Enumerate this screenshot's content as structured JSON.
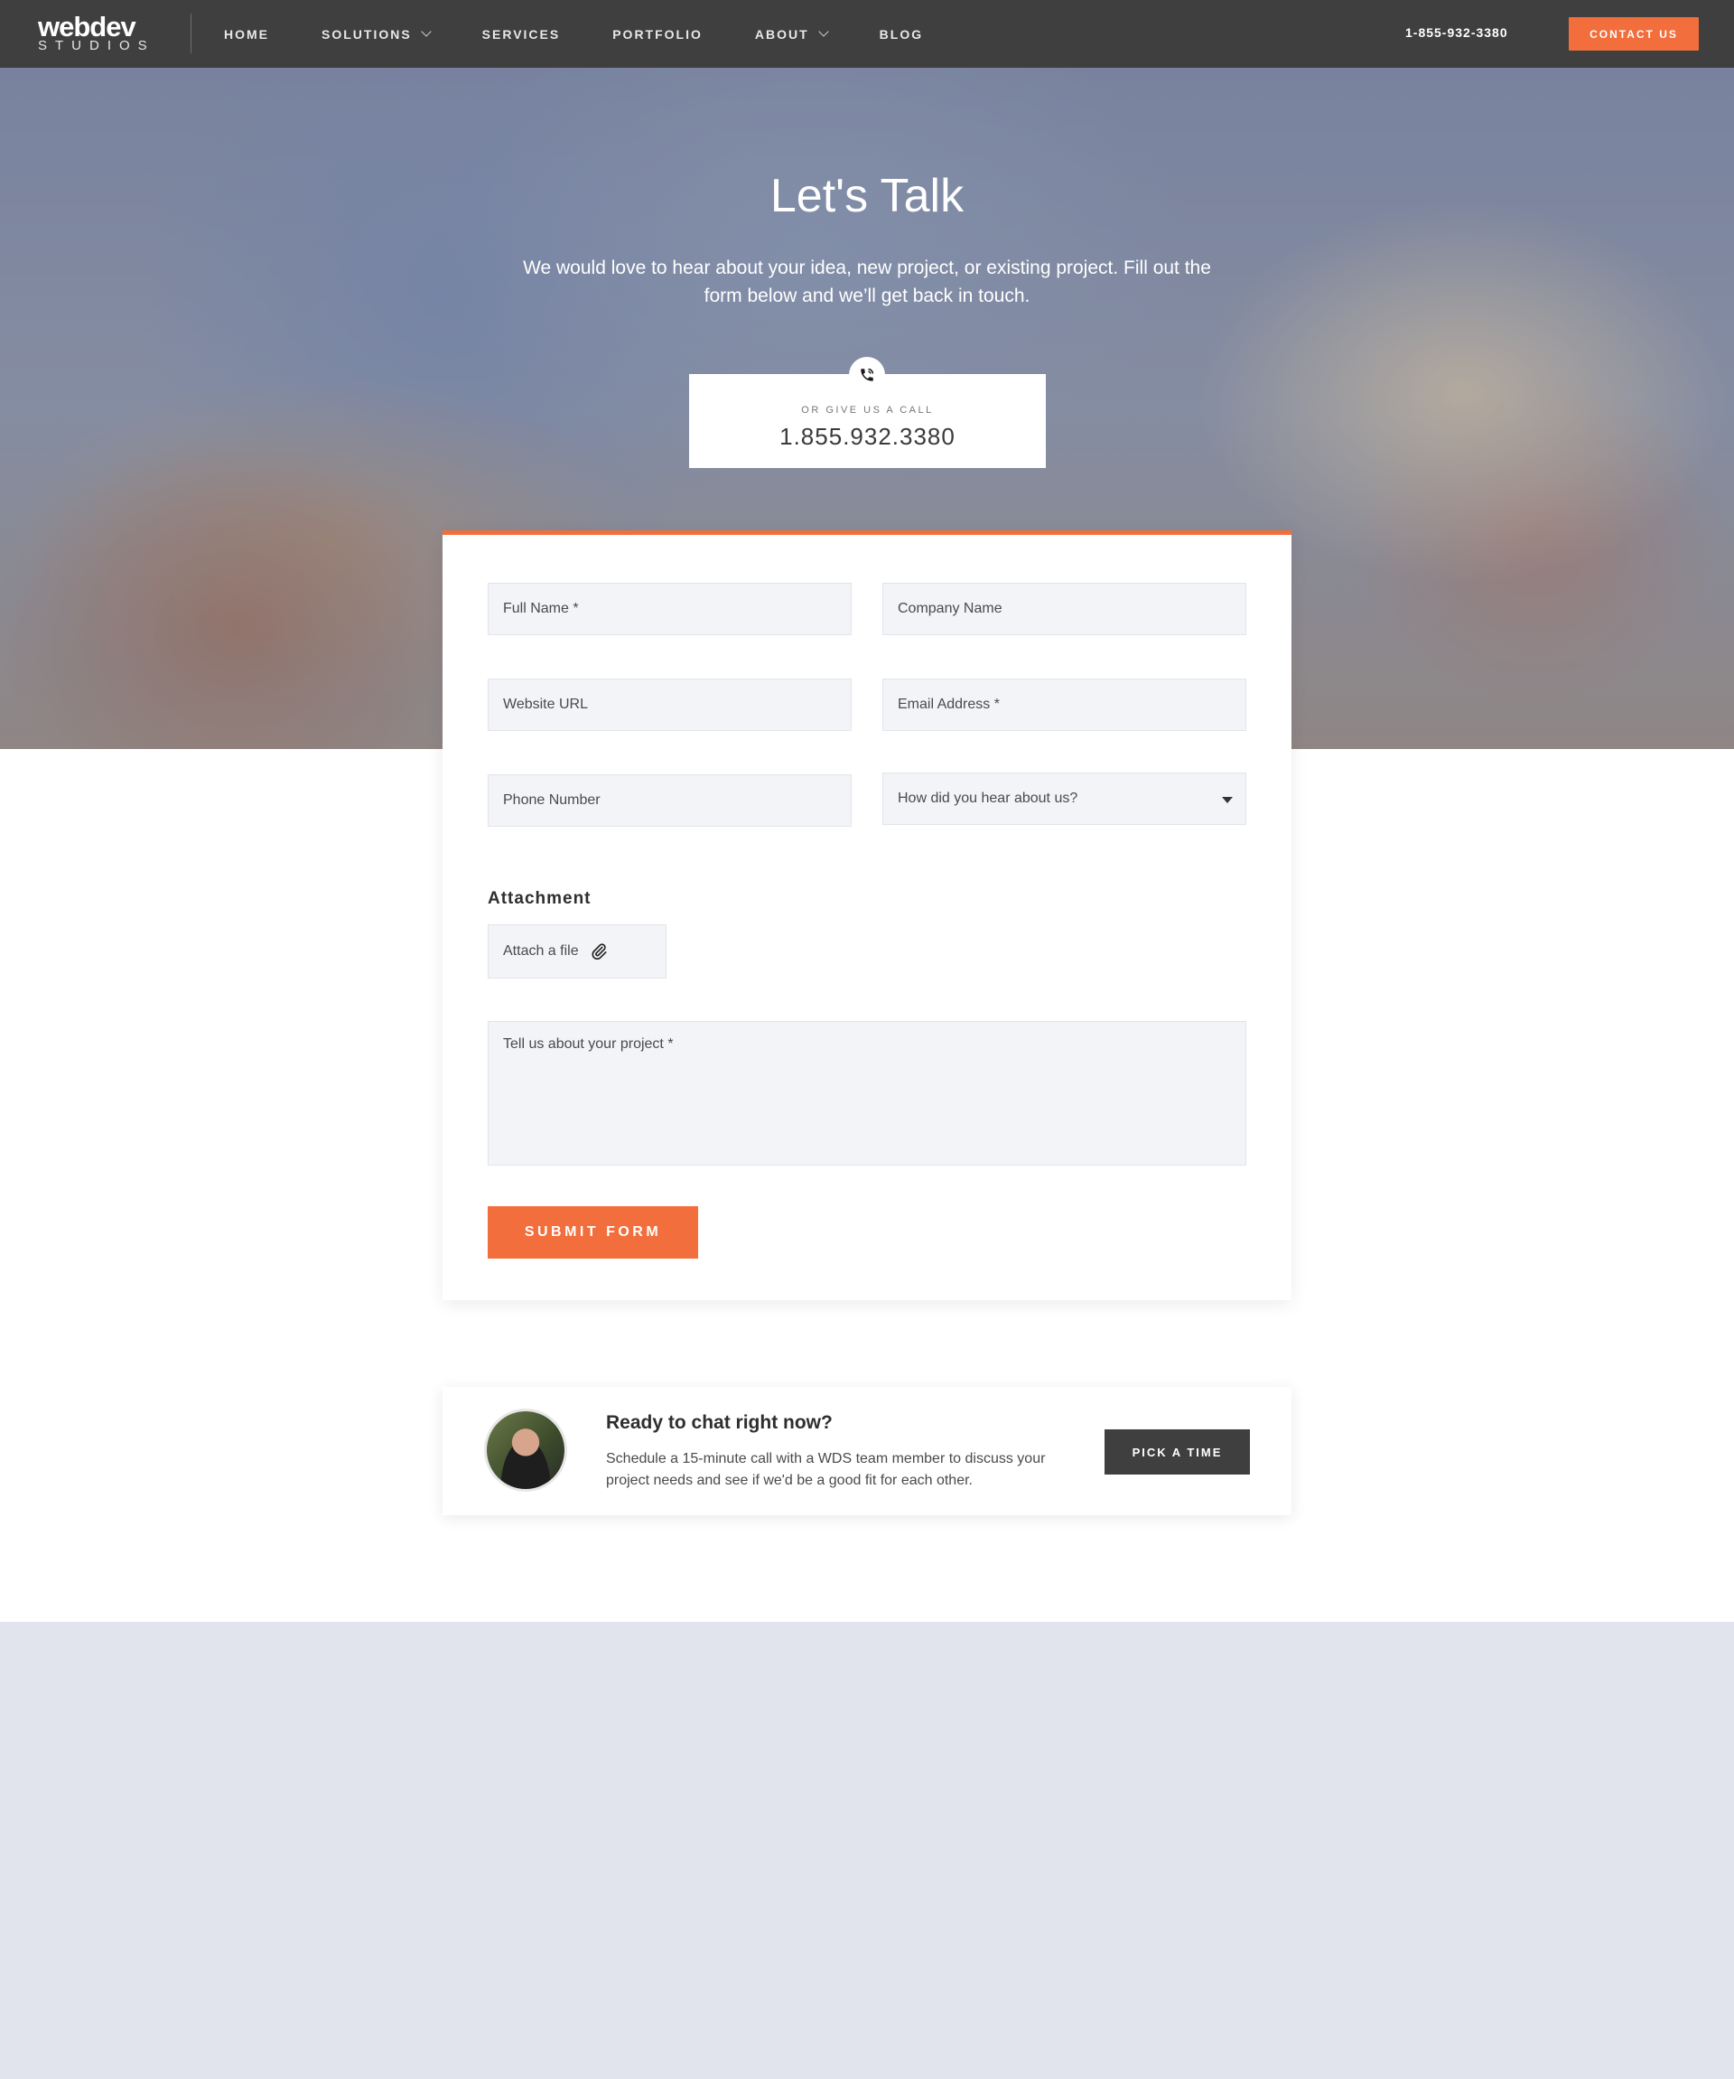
{
  "nav": {
    "logo_main": "webdev",
    "logo_sub": "STUDIOS",
    "items": [
      {
        "label": "HOME",
        "dropdown": false
      },
      {
        "label": "SOLUTIONS",
        "dropdown": true
      },
      {
        "label": "SERVICES",
        "dropdown": false
      },
      {
        "label": "PORTFOLIO",
        "dropdown": false
      },
      {
        "label": "ABOUT",
        "dropdown": true
      },
      {
        "label": "BLOG",
        "dropdown": false
      }
    ],
    "phone": "1-855-932-3380",
    "cta_label": "CONTACT US"
  },
  "hero": {
    "title": "Let's Talk",
    "subtitle": "We would love to hear about your idea, new project, or existing project. Fill out the form below and we’ll get back in touch."
  },
  "call": {
    "label": "OR GIVE US A CALL",
    "number": "1.855.932.3380",
    "icon": "phone-icon"
  },
  "form": {
    "full_name_placeholder": "Full Name *",
    "company_placeholder": "Company Name",
    "website_placeholder": "Website URL",
    "email_placeholder": "Email Address *",
    "phone_placeholder": "Phone Number",
    "referral_selected": "How did you hear about us?",
    "attachment_heading": "Attachment",
    "attach_label": "Attach a file",
    "project_placeholder": "Tell us about your project *",
    "submit_label": "SUBMIT FORM"
  },
  "chat": {
    "title": "Ready to chat right now?",
    "text": "Schedule a 15-minute call with a WDS team member to discuss your project needs and see if we'd be a good fit for each other.",
    "button_label": "PICK A TIME"
  },
  "colors": {
    "accent": "#f26e3c",
    "nav_bg": "#3e3f3e",
    "footer_bg": "#e1e4ec",
    "field_bg": "#f3f4f8"
  }
}
